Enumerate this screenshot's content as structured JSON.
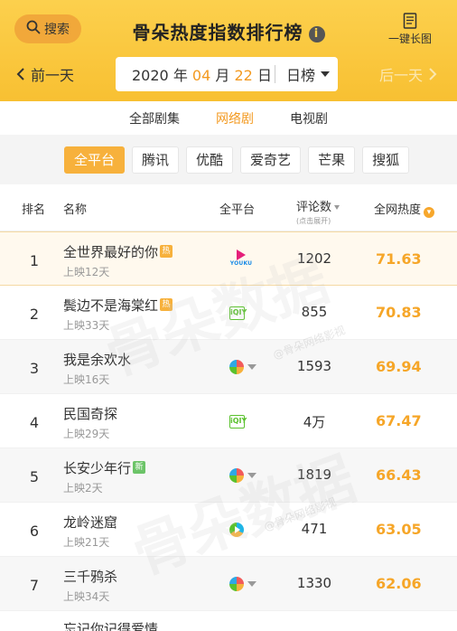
{
  "header": {
    "search_label": "搜索",
    "title": "骨朵热度指数排行榜",
    "info_icon": "info-icon",
    "long_image_label": "一键长图",
    "prev_day": "前一天",
    "next_day": "后一天",
    "date": {
      "year": "2020",
      "year_unit": "年",
      "month": "04",
      "month_unit": "月",
      "day": "22",
      "day_unit": "日"
    },
    "mode": "日榜",
    "colors": {
      "accent": "#f8c032",
      "highlight": "#f39a21"
    }
  },
  "category_tabs": [
    {
      "label": "全部剧集",
      "active": false
    },
    {
      "label": "网络剧",
      "active": true
    },
    {
      "label": "电视剧",
      "active": false
    }
  ],
  "platforms": [
    {
      "label": "全平台",
      "active": true
    },
    {
      "label": "腾讯",
      "active": false
    },
    {
      "label": "优酷",
      "active": false
    },
    {
      "label": "爱奇艺",
      "active": false
    },
    {
      "label": "芒果",
      "active": false
    },
    {
      "label": "搜狐",
      "active": false
    }
  ],
  "table_header": {
    "rank": "排名",
    "name": "名称",
    "platform": "全平台",
    "comments": "评论数",
    "comments_sub": "(点击展开)",
    "heat": "全网热度"
  },
  "rows": [
    {
      "rank": "1",
      "name": "全世界最好的你",
      "badge": "热",
      "days": "上映12天",
      "platform_icon": "youku-icon",
      "platform_text": "YOUKU",
      "comments": "1202",
      "heat": "71.63"
    },
    {
      "rank": "2",
      "name": "鬓边不是海棠红",
      "badge": "热",
      "days": "上映33天",
      "platform_icon": "iqiyi-icon",
      "platform_text": "iQIY",
      "comments": "855",
      "heat": "70.83"
    },
    {
      "rank": "3",
      "name": "我是余欢水",
      "badge": "",
      "days": "上映16天",
      "platform_icon": "multi-platform-icon",
      "platform_text": "",
      "comments": "1593",
      "heat": "69.94"
    },
    {
      "rank": "4",
      "name": "民国奇探",
      "badge": "",
      "days": "上映29天",
      "platform_icon": "iqiyi-icon",
      "platform_text": "iQIY",
      "comments": "4万",
      "heat": "67.47"
    },
    {
      "rank": "5",
      "name": "长安少年行",
      "badge": "新",
      "days": "上映2天",
      "platform_icon": "multi-platform-icon",
      "platform_text": "",
      "comments": "1819",
      "heat": "66.43"
    },
    {
      "rank": "6",
      "name": "龙岭迷窟",
      "badge": "",
      "days": "上映21天",
      "platform_icon": "tencent-video-icon",
      "platform_text": "",
      "comments": "471",
      "heat": "63.05"
    },
    {
      "rank": "7",
      "name": "三千鸦杀",
      "badge": "",
      "days": "上映34天",
      "platform_icon": "multi-platform-icon",
      "platform_text": "",
      "comments": "1330",
      "heat": "62.06"
    }
  ],
  "partial_row_name": "忘记你记得爱情",
  "watermark": {
    "big": "骨朵数据",
    "small": "@骨朵网络影视"
  }
}
